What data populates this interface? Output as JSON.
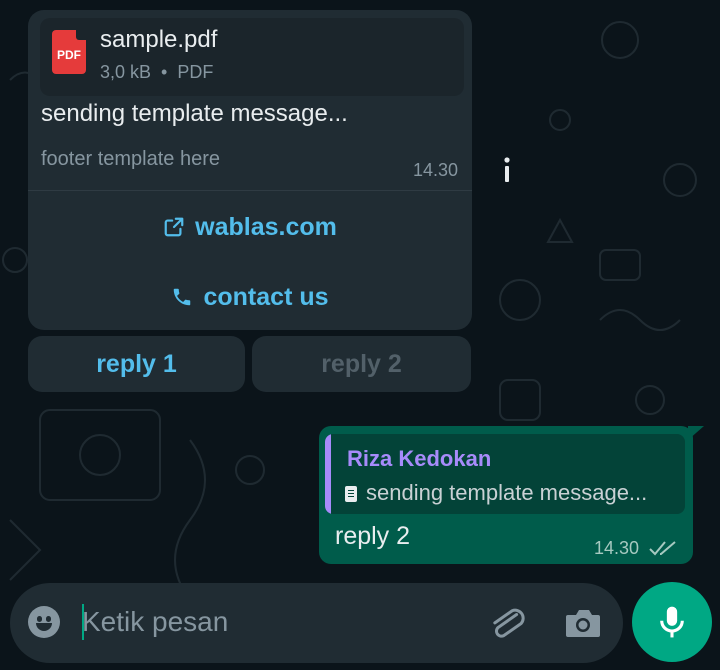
{
  "colors": {
    "background": "#0b141a",
    "incoming_bubble": "#202c33",
    "outgoing_bubble": "#005c4b",
    "link": "#53bdeb",
    "accent": "#00a884",
    "quote_name": "#a78bfa"
  },
  "incoming_message": {
    "attachment": {
      "icon": "pdf-file-icon",
      "icon_label": "PDF",
      "file_name": "sample.pdf",
      "file_size": "3,0 kB",
      "separator": "•",
      "file_type": "PDF"
    },
    "body": "sending template message...",
    "footer": "footer template here",
    "time": "14.30",
    "link_button": {
      "icon": "external-link-icon",
      "label": "wablas.com"
    },
    "call_button": {
      "icon": "phone-icon",
      "label": "contact us"
    },
    "info_icon": "info-icon"
  },
  "quick_replies": [
    {
      "label": "reply 1",
      "enabled": true
    },
    {
      "label": "reply 2",
      "enabled": false
    }
  ],
  "outgoing_message": {
    "quote": {
      "sender": "Riza Kedokan",
      "icon": "document-icon",
      "text": "sending template message..."
    },
    "text": "reply 2",
    "time": "14.30",
    "status_icon": "double-check-icon"
  },
  "composer": {
    "placeholder": "Ketik pesan",
    "emoji_icon": "emoji-icon",
    "attach_icon": "paperclip-icon",
    "camera_icon": "camera-icon",
    "mic_icon": "microphone-icon"
  }
}
